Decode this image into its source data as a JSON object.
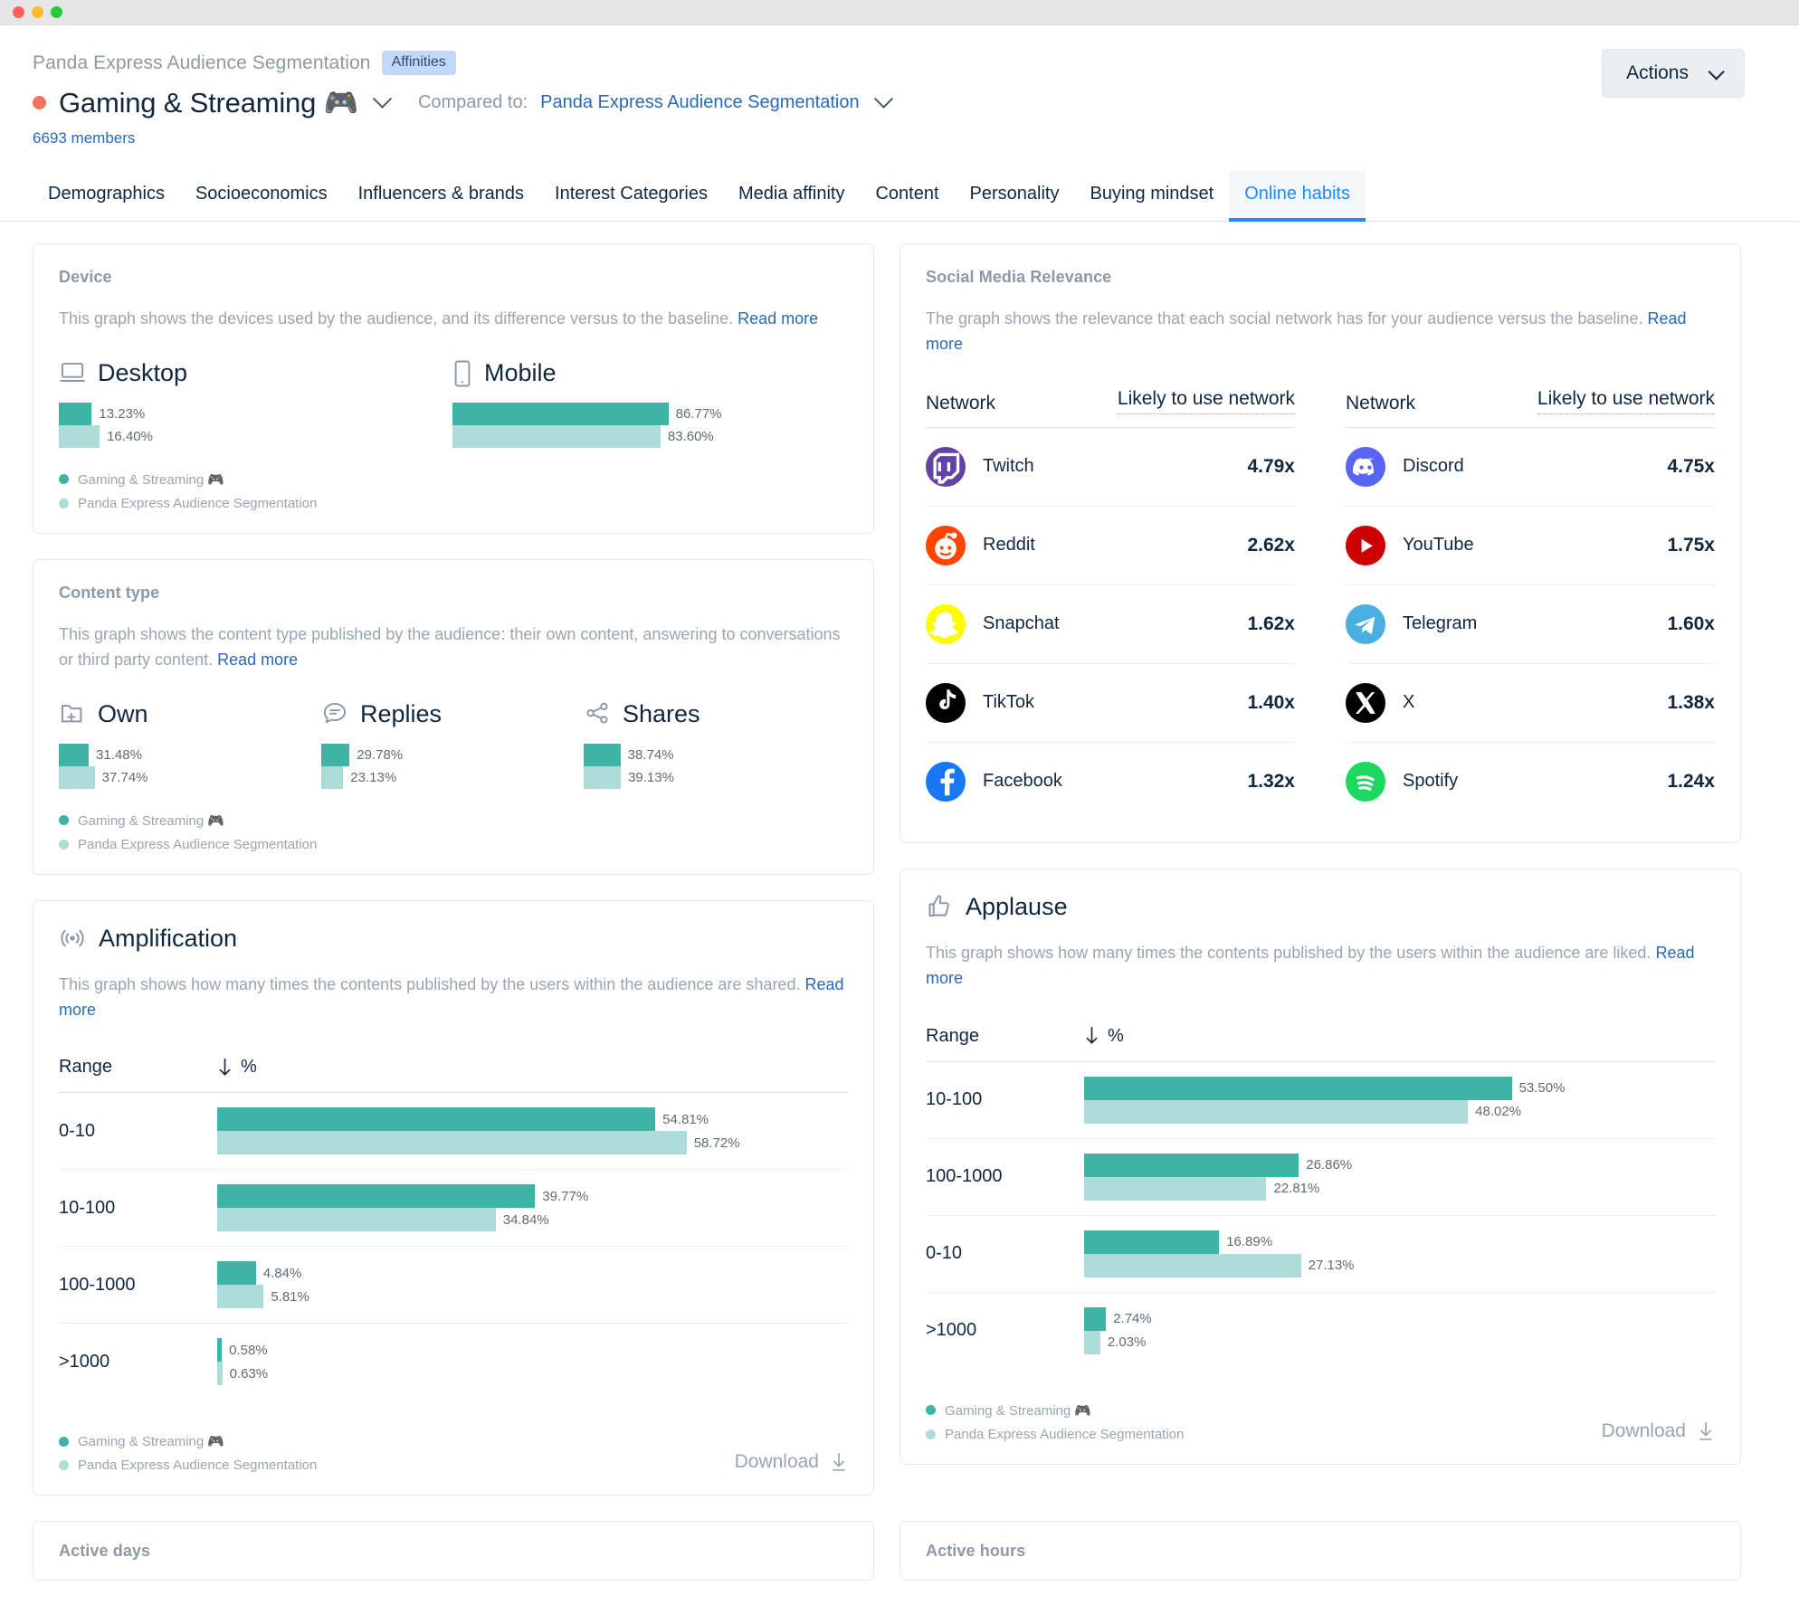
{
  "window": {
    "traffic_lights": [
      "close-red",
      "minimize-yellow",
      "maximize-green"
    ]
  },
  "header": {
    "breadcrumb": "Panda Express Audience Segmentation",
    "chip": "Affinities",
    "segment_title": "Gaming & Streaming 🎮",
    "compared_label": "Compared to:",
    "compared_value": "Panda Express Audience Segmentation",
    "members": "6693 members",
    "actions_label": "Actions"
  },
  "tabs": [
    {
      "label": "Demographics",
      "active": false
    },
    {
      "label": "Socioeconomics",
      "active": false
    },
    {
      "label": "Influencers & brands",
      "active": false
    },
    {
      "label": "Interest Categories",
      "active": false
    },
    {
      "label": "Media affinity",
      "active": false
    },
    {
      "label": "Content",
      "active": false
    },
    {
      "label": "Personality",
      "active": false
    },
    {
      "label": "Buying mindset",
      "active": false
    },
    {
      "label": "Online habits",
      "active": true
    }
  ],
  "legend": {
    "primary": "Gaming & Streaming 🎮",
    "baseline": "Panda Express Audience Segmentation",
    "primary_color": "#3fb3a5",
    "baseline_color": "#aedcd8"
  },
  "device": {
    "title": "Device",
    "desc": "This graph shows the devices used by the audience, and its difference versus to the baseline. ",
    "read_more": "Read more"
  },
  "content_type": {
    "title": "Content type",
    "desc": "This graph shows the content type published by the audience: their own content, answering to conversations or third party content. ",
    "read_more": "Read more"
  },
  "social": {
    "title": "Social Media Relevance",
    "desc": "The graph shows the relevance that each social network has for your audience versus the baseline. ",
    "read_more": "Read more",
    "col_network": "Network",
    "col_metric": "Likely to use network"
  },
  "amplification": {
    "title": "Amplification",
    "icon": "broadcast-icon",
    "desc": "This graph shows how many times the contents published by the users within the audience are shared. ",
    "read_more": "Read more",
    "col_range": "Range",
    "col_pct": "%",
    "download": "Download"
  },
  "applause": {
    "title": "Applause",
    "icon": "thumbs-up-icon",
    "desc": "This graph shows how many times the contents published by the users within the audience are liked. ",
    "read_more": "Read more",
    "col_range": "Range",
    "col_pct": "%",
    "download": "Download"
  },
  "bottom": {
    "active_days": "Active days",
    "active_hours": "Active hours"
  },
  "chart_data": [
    {
      "type": "bar",
      "title": "Device",
      "categories": [
        "Desktop",
        "Mobile"
      ],
      "series": [
        {
          "name": "Gaming & Streaming 🎮",
          "values": [
            13.23,
            86.77
          ],
          "labels": [
            "13.23%",
            "86.77%"
          ],
          "color": "#3fb3a5"
        },
        {
          "name": "Panda Express Audience Segmentation",
          "values": [
            16.4,
            83.6
          ],
          "labels": [
            "16.40%",
            "83.60%"
          ],
          "color": "#aedcd8"
        }
      ],
      "icons": [
        "desktop-icon",
        "mobile-icon"
      ],
      "ylabel": "%",
      "ylim": [
        0,
        100
      ],
      "grid": false,
      "legend": "bottom-left"
    },
    {
      "type": "bar",
      "title": "Content type",
      "categories": [
        "Own",
        "Replies",
        "Shares"
      ],
      "series": [
        {
          "name": "Gaming & Streaming 🎮",
          "values": [
            31.48,
            29.78,
            38.74
          ],
          "labels": [
            "31.48%",
            "29.78%",
            "38.74%"
          ],
          "color": "#3fb3a5"
        },
        {
          "name": "Panda Express Audience Segmentation",
          "values": [
            37.74,
            23.13,
            39.13
          ],
          "labels": [
            "37.74%",
            "23.13%",
            "39.13%"
          ],
          "color": "#aedcd8"
        }
      ],
      "icons": [
        "folder-plus-icon",
        "reply-bubble-icon",
        "share-icon"
      ],
      "ylabel": "%",
      "ylim": [
        0,
        100
      ],
      "grid": false,
      "legend": "bottom-left"
    },
    {
      "type": "table",
      "title": "Social Media Relevance",
      "columns": [
        "Network",
        "Likely to use network"
      ],
      "left_rows": [
        {
          "name": "Twitch",
          "icon": "twitch-icon",
          "color": "#6441a5",
          "value": "4.79x",
          "numeric": 4.79
        },
        {
          "name": "Reddit",
          "icon": "reddit-icon",
          "color": "#ff4500",
          "value": "2.62x",
          "numeric": 2.62
        },
        {
          "name": "Snapchat",
          "icon": "snapchat-icon",
          "color": "#fffc00",
          "value": "1.62x",
          "numeric": 1.62
        },
        {
          "name": "TikTok",
          "icon": "tiktok-icon",
          "color": "#010101",
          "value": "1.40x",
          "numeric": 1.4
        },
        {
          "name": "Facebook",
          "icon": "facebook-icon",
          "color": "#1877f2",
          "value": "1.32x",
          "numeric": 1.32
        }
      ],
      "right_rows": [
        {
          "name": "Discord",
          "icon": "discord-icon",
          "color": "#5865f2",
          "value": "4.75x",
          "numeric": 4.75
        },
        {
          "name": "YouTube",
          "icon": "youtube-icon",
          "color": "#cc0000",
          "value": "1.75x",
          "numeric": 1.75
        },
        {
          "name": "Telegram",
          "icon": "telegram-icon",
          "color": "#4aaee0",
          "value": "1.60x",
          "numeric": 1.6
        },
        {
          "name": "X",
          "icon": "x-twitter-icon",
          "color": "#000000",
          "value": "1.38x",
          "numeric": 1.38
        },
        {
          "name": "Spotify",
          "icon": "spotify-icon",
          "color": "#1ed760",
          "value": "1.24x",
          "numeric": 1.24
        }
      ]
    },
    {
      "type": "bar",
      "title": "Amplification",
      "orientation": "horizontal",
      "categories": [
        "0-10",
        "10-100",
        "100-1000",
        ">1000"
      ],
      "series": [
        {
          "name": "Gaming & Streaming 🎮",
          "values": [
            54.81,
            39.77,
            4.84,
            0.58
          ],
          "labels": [
            "54.81%",
            "39.77%",
            "4.84%",
            "0.58%"
          ],
          "color": "#3fb3a5"
        },
        {
          "name": "Panda Express Audience Segmentation",
          "values": [
            58.72,
            34.84,
            5.81,
            0.63
          ],
          "labels": [
            "58.72%",
            "34.84%",
            "5.81%",
            "0.63%"
          ],
          "color": "#aedcd8"
        }
      ],
      "xlabel": "%",
      "xlim": [
        0,
        60
      ],
      "grid": false,
      "sort": "descending"
    },
    {
      "type": "bar",
      "title": "Applause",
      "orientation": "horizontal",
      "categories": [
        "10-100",
        "100-1000",
        "0-10",
        ">1000"
      ],
      "series": [
        {
          "name": "Gaming & Streaming 🎮",
          "values": [
            53.5,
            26.86,
            16.89,
            2.74
          ],
          "labels": [
            "53.50%",
            "26.86%",
            "16.89%",
            "2.74%"
          ],
          "color": "#3fb3a5"
        },
        {
          "name": "Panda Express Audience Segmentation",
          "values": [
            48.02,
            22.81,
            27.13,
            2.03
          ],
          "labels": [
            "48.02%",
            "22.81%",
            "27.13%",
            "2.03%"
          ],
          "color": "#aedcd8"
        }
      ],
      "xlabel": "%",
      "xlim": [
        0,
        60
      ],
      "grid": false,
      "sort": "descending"
    }
  ]
}
